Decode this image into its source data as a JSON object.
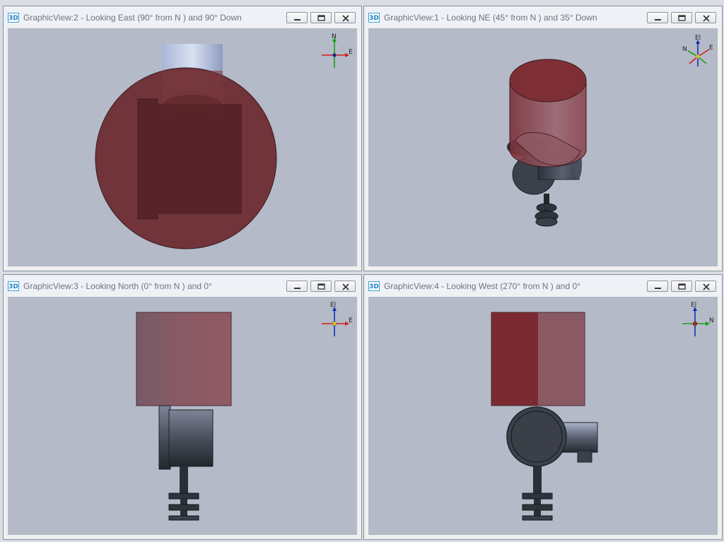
{
  "views": [
    {
      "badge": "3D",
      "title": "GraphicView:2 - Looking East (90° from N ) and 90° Down",
      "triad": {
        "up": "N",
        "right": "E"
      }
    },
    {
      "badge": "3D",
      "title": "GraphicView:1 - Looking NE (45° from N ) and 35° Down",
      "triad": {
        "up": "El",
        "left": "N",
        "right": "E"
      }
    },
    {
      "badge": "3D",
      "title": "GraphicView:3 - Looking North (0° from N ) and 0°",
      "triad": {
        "up": "El",
        "right": "E"
      }
    },
    {
      "badge": "3D",
      "title": "GraphicView:4 - Looking West (270° from N ) and 0°",
      "triad": {
        "up": "El",
        "right": "N"
      }
    }
  ],
  "window_buttons": [
    "minimize-button",
    "restore-button",
    "close-button"
  ]
}
